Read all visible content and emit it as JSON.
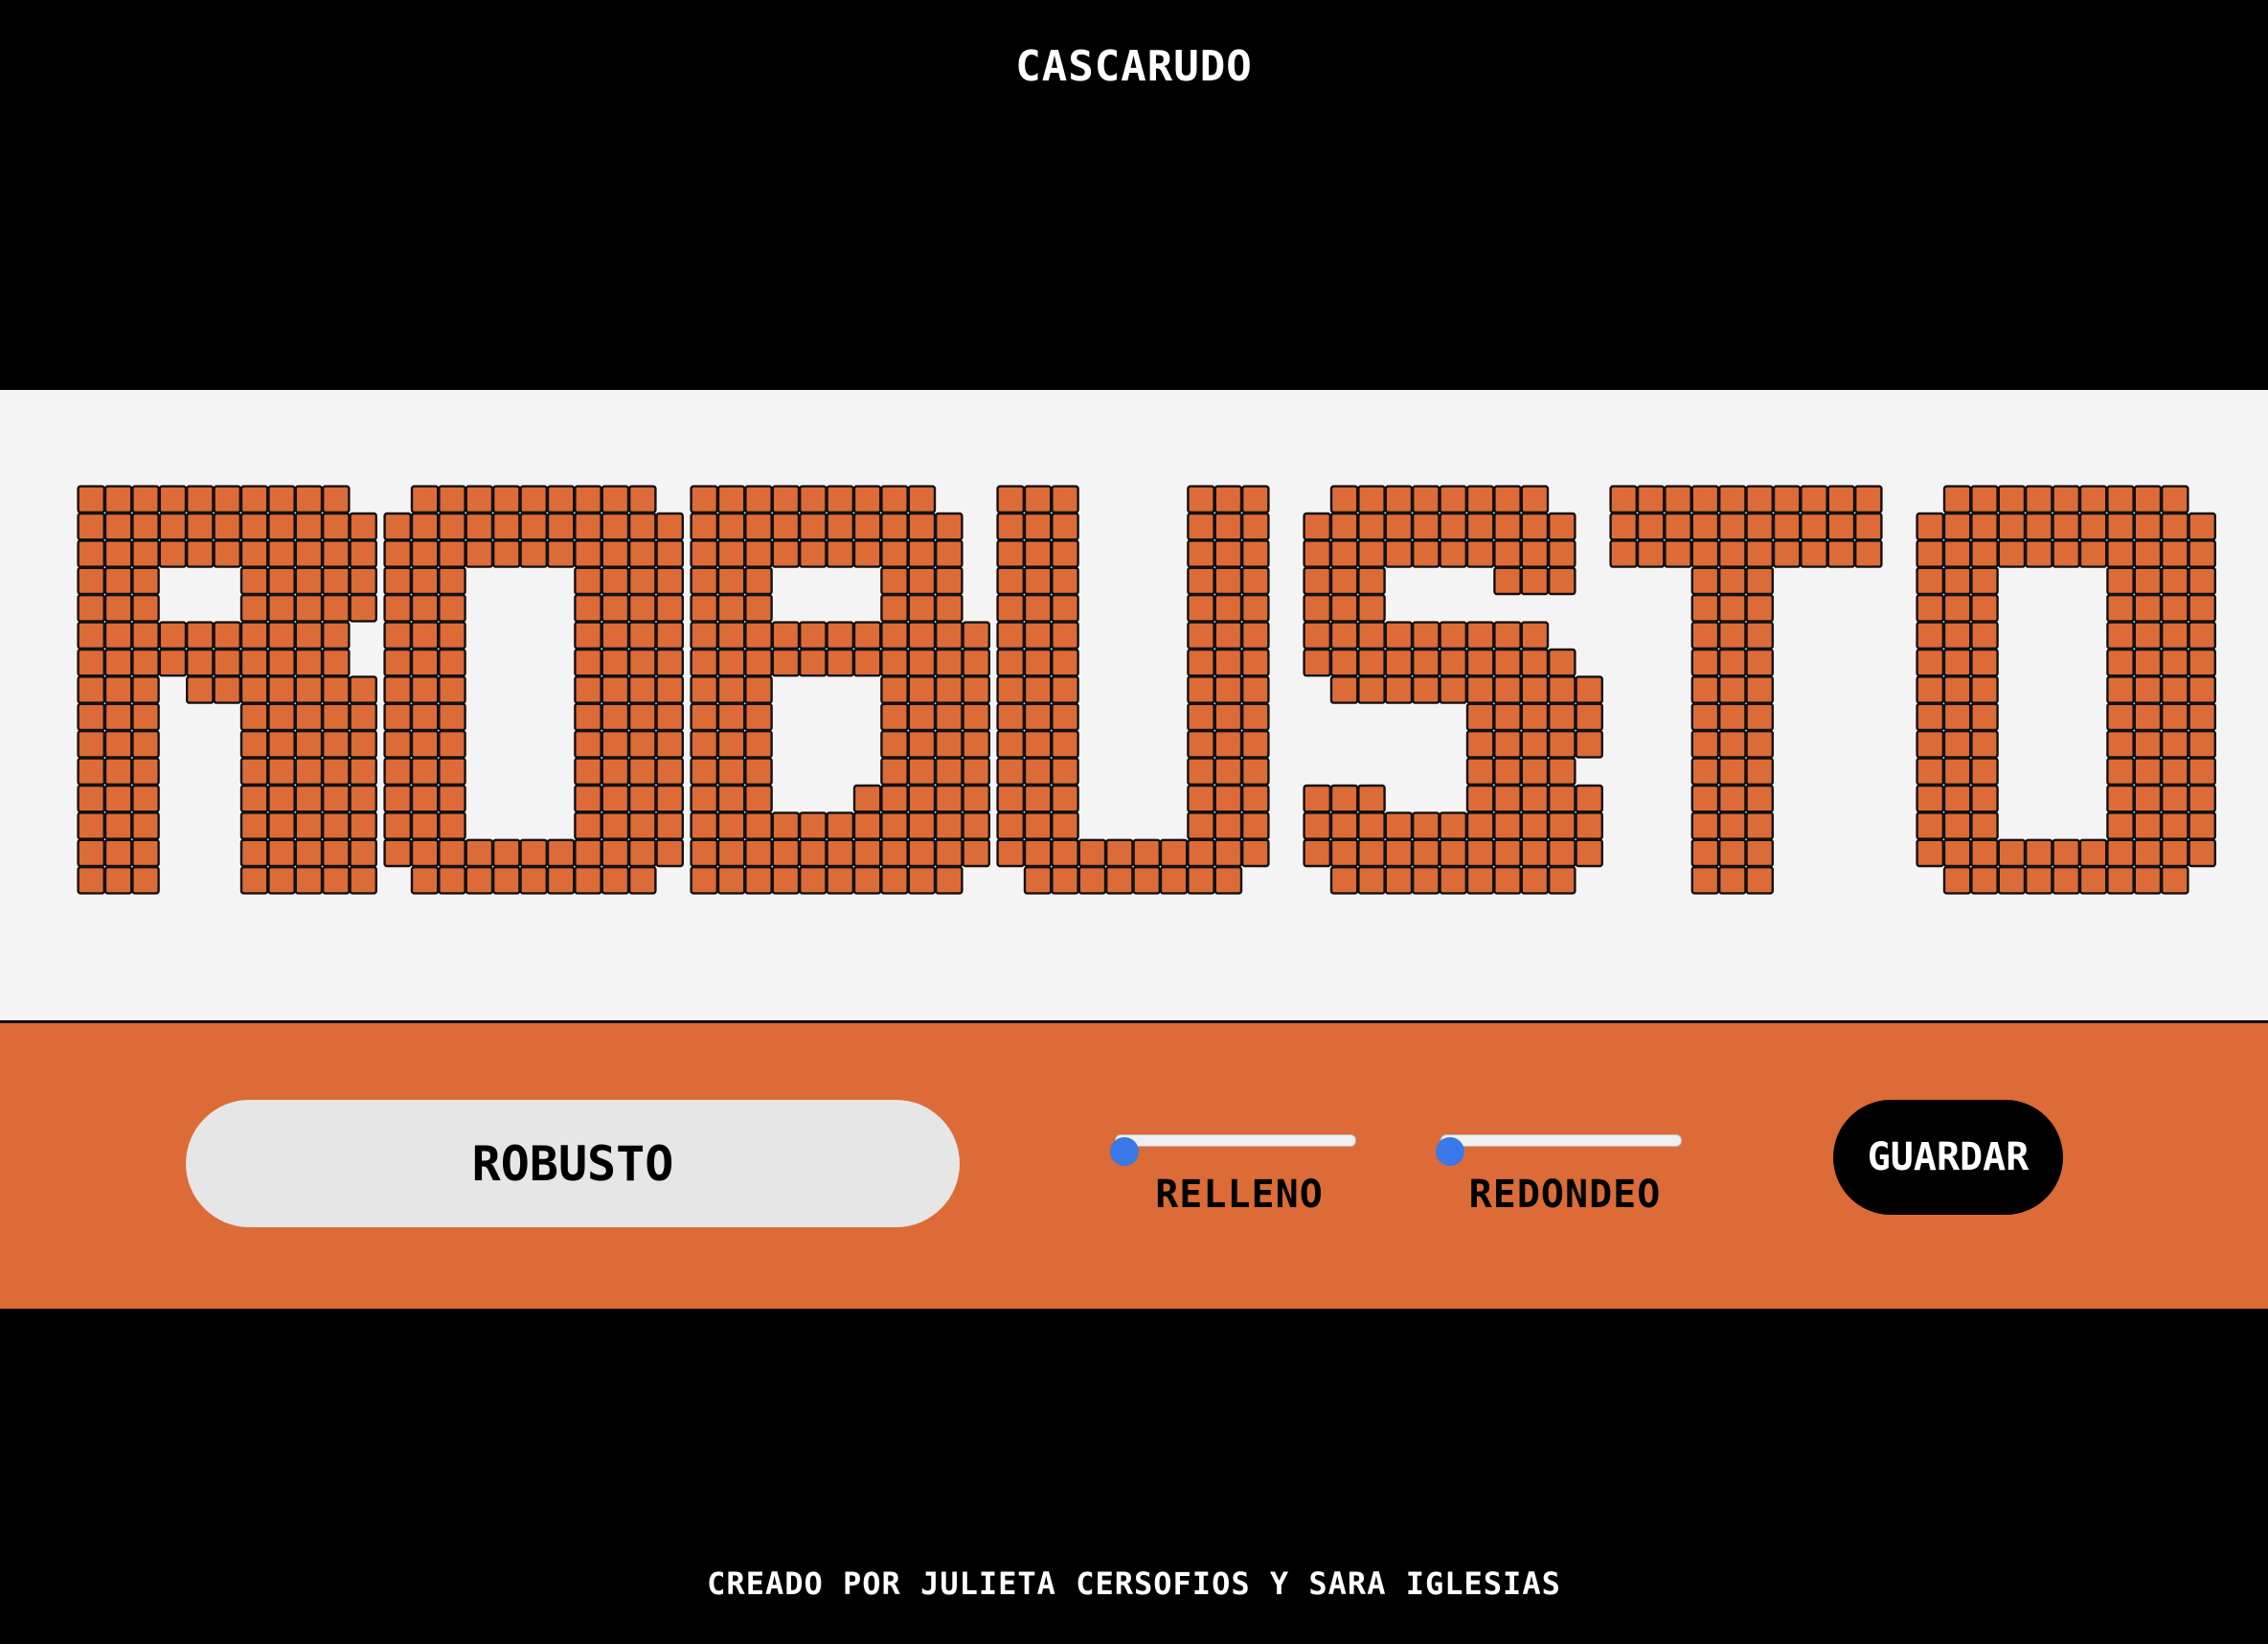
{
  "header": {
    "title": "CASCARUDO"
  },
  "preview": {
    "word": "ROBUSTO",
    "cell_fill": "#dc6b38",
    "cell_stroke": "#111111",
    "glyphs": {
      "R": [
        "##########.",
        "###########",
        "###########",
        "###...#####",
        "###...#####",
        "##########.",
        "##########.",
        "###.#######",
        "###...#####",
        "###...#####",
        "###...#####",
        "###...#####",
        "###...#####",
        "###...#####",
        "###...#####"
      ],
      "O": [
        ".#########.",
        "###########",
        "###########",
        "###....####",
        "###....####",
        "###....####",
        "###....####",
        "###....####",
        "###....####",
        "###....####",
        "###....####",
        "###....####",
        "###....####",
        "###########",
        ".#########."
      ],
      "B": [
        "#########..",
        "##########.",
        "##########.",
        "###....###.",
        "###....###.",
        "###########",
        "###########",
        "###....####",
        "###....####",
        "###....####",
        "###....####",
        "###...#####",
        "###########",
        "###########",
        "##########."
      ],
      "U": [
        "###....###.",
        "###....###.",
        "###....###.",
        "###....###.",
        "###....###.",
        "###....###.",
        "###....###.",
        "###....###.",
        "###....###.",
        "###....###.",
        "###....###.",
        "###....###.",
        "###....###.",
        "##########.",
        ".########.."
      ],
      "S": [
        ".########..",
        "##########.",
        "##########.",
        "###....###.",
        "###........",
        "#########..",
        "##########.",
        ".##########",
        "......#####",
        "......#####",
        "......####.",
        "###...#####",
        "###########",
        "###########",
        ".#########."
      ],
      "T": [
        "##########.",
        "##########.",
        "##########.",
        "...###.....",
        "...###.....",
        "...###.....",
        "...###.....",
        "...###.....",
        "...###.....",
        "...###.....",
        "...###.....",
        "...###.....",
        "...###.....",
        "...###.....",
        "...###....."
      ]
    }
  },
  "controls": {
    "text_value": "ROBUSTO",
    "relleno": {
      "label": "RELLENO",
      "value": 0
    },
    "redondeo": {
      "label": "REDONDEO",
      "value": 0
    },
    "save_label": "GUARDAR",
    "accent": "#dc6b38",
    "slider_color": "#3b78e7"
  },
  "footer": {
    "credit": "CREADO POR JULIETA CERSOFIOS Y SARA IGLESIAS"
  }
}
